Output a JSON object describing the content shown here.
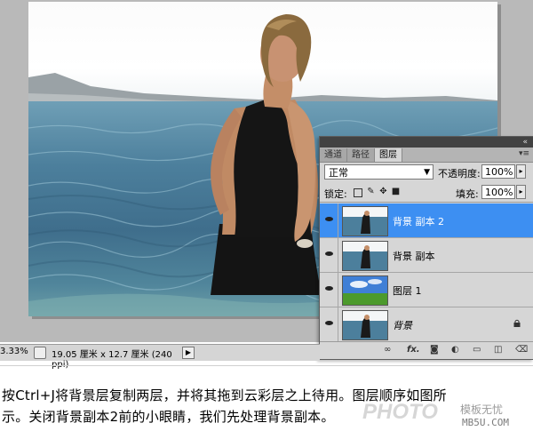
{
  "panel": {
    "tabs": [
      "通道",
      "路径",
      "图层"
    ],
    "blend_mode": "正常",
    "opacity_label": "不透明度:",
    "opacity_value": "100%",
    "lock_label": "锁定:",
    "fill_label": "填充:",
    "fill_value": "100%",
    "layers": [
      {
        "name": "背景 副本 2",
        "selected": true,
        "visible": true
      },
      {
        "name": "背景 副本",
        "selected": false,
        "visible": true
      },
      {
        "name": "图层 1",
        "selected": false,
        "visible": true
      },
      {
        "name": "背景",
        "selected": false,
        "visible": true,
        "locked": true
      }
    ],
    "footer_icons": [
      "link-icon",
      "fx-icon",
      "mask-icon",
      "adjustment-icon",
      "folder-icon",
      "new-layer-icon",
      "trash-icon"
    ],
    "fx_label": "fx."
  },
  "status": {
    "zoom": "3.33%",
    "doc_info": "19.05 厘米 x 12.7 厘米 (240 ppi)"
  },
  "caption": {
    "line1": "按Ctrl+J将背景层复制两层，并将其拖到云彩层之上待用。图层顺序如图所",
    "line2": "示。关闭背景副本2前的小眼睛，我们先处理背景副本。"
  },
  "watermark": {
    "logo": "PHOTO",
    "cn": "模板无忧",
    "url": "MB5U.COM"
  }
}
